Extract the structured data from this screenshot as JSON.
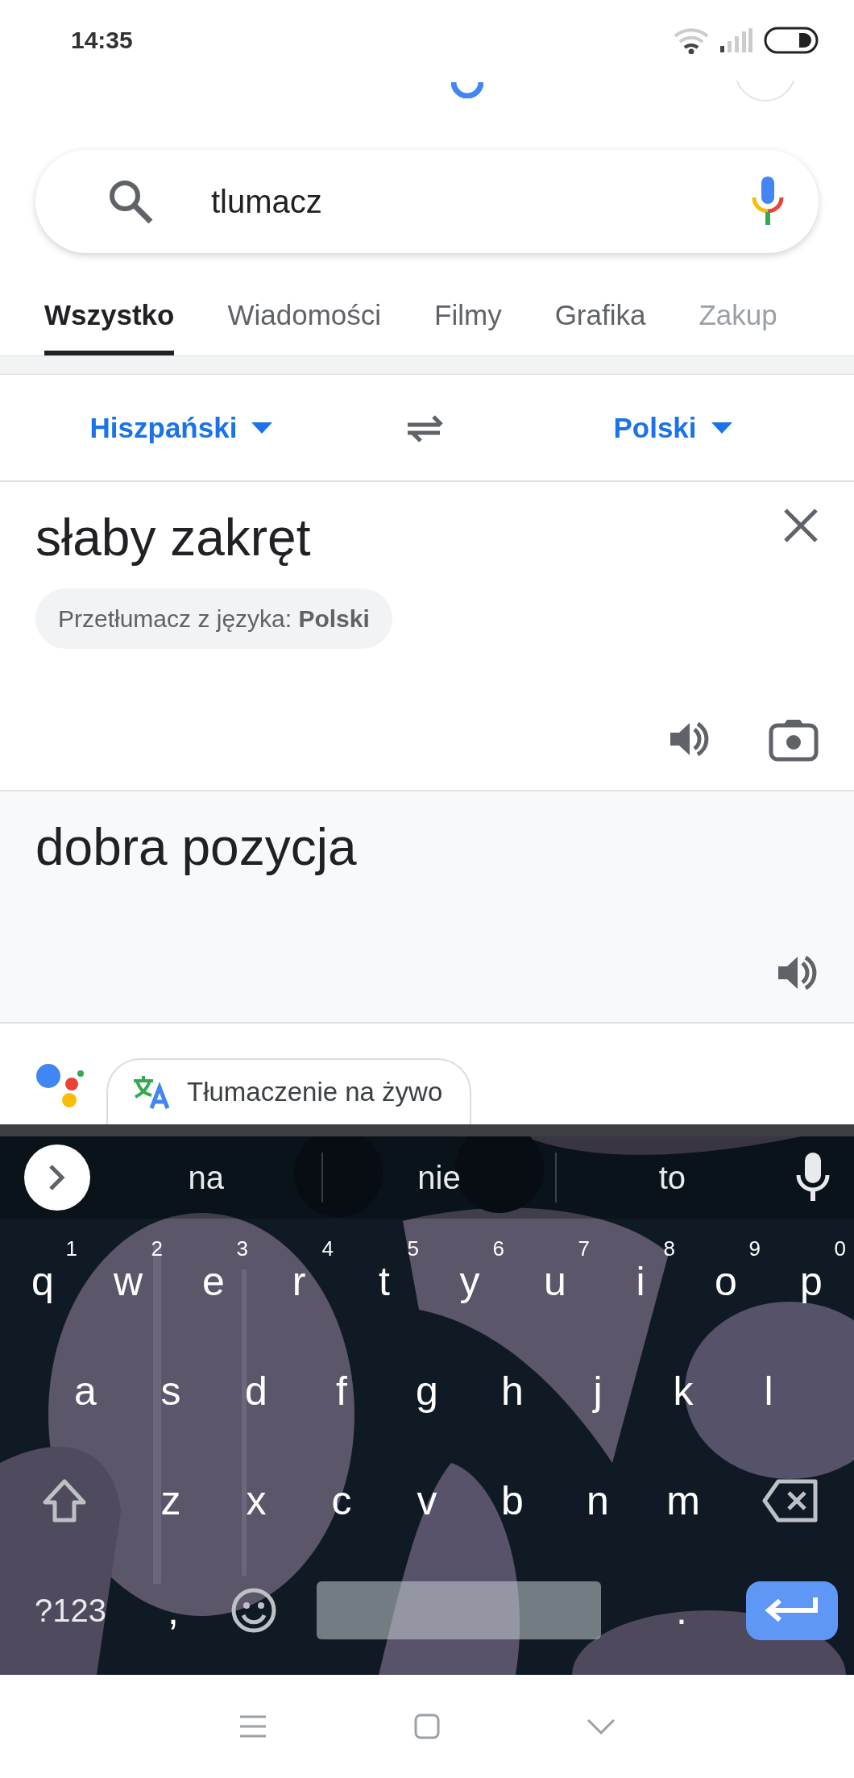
{
  "status_bar": {
    "time": "14:35"
  },
  "search": {
    "value": "tlumacz"
  },
  "tabs": [
    {
      "label": "Wszystko",
      "selected": true
    },
    {
      "label": "Wiadomości",
      "selected": false
    },
    {
      "label": "Filmy",
      "selected": false
    },
    {
      "label": "Grafika",
      "selected": false
    },
    {
      "label": "Zakup",
      "selected": false
    }
  ],
  "translator": {
    "source_language": "Hiszpański",
    "target_language": "Polski",
    "input_text": "słaby zakręt",
    "detect_chip": "Przetłumacz z języka: **Polski**",
    "output_text": "dobra pozycja"
  },
  "assistant": {
    "chip": "Tłumaczenie na żywo"
  },
  "keyboard": {
    "suggestions": [
      "na",
      "nie",
      "to"
    ],
    "rows": [
      [
        {
          "kind": "letter",
          "label": "q",
          "hint": "1"
        },
        {
          "kind": "letter",
          "label": "w",
          "hint": "2"
        },
        {
          "kind": "letter",
          "label": "e",
          "hint": "3"
        },
        {
          "kind": "letter",
          "label": "r",
          "hint": "4"
        },
        {
          "kind": "letter",
          "label": "t",
          "hint": "5"
        },
        {
          "kind": "letter",
          "label": "y",
          "hint": "6"
        },
        {
          "kind": "letter",
          "label": "u",
          "hint": "7"
        },
        {
          "kind": "letter",
          "label": "i",
          "hint": "8"
        },
        {
          "kind": "letter",
          "label": "o",
          "hint": "9"
        },
        {
          "kind": "letter",
          "label": "p",
          "hint": "0"
        }
      ],
      [
        {
          "kind": "letter",
          "label": "a"
        },
        {
          "kind": "letter",
          "label": "s"
        },
        {
          "kind": "letter",
          "label": "d"
        },
        {
          "kind": "letter",
          "label": "f"
        },
        {
          "kind": "letter",
          "label": "g"
        },
        {
          "kind": "letter",
          "label": "h"
        },
        {
          "kind": "letter",
          "label": "j"
        },
        {
          "kind": "letter",
          "label": "k"
        },
        {
          "kind": "letter",
          "label": "l"
        }
      ],
      [
        {
          "kind": "shift"
        },
        {
          "kind": "letter",
          "label": "z"
        },
        {
          "kind": "letter",
          "label": "x"
        },
        {
          "kind": "letter",
          "label": "c"
        },
        {
          "kind": "letter",
          "label": "v"
        },
        {
          "kind": "letter",
          "label": "b"
        },
        {
          "kind": "letter",
          "label": "n"
        },
        {
          "kind": "letter",
          "label": "m"
        },
        {
          "kind": "backspace"
        }
      ]
    ],
    "bottom_keys": [
      {
        "kind": "symbols",
        "label": "?123"
      },
      {
        "kind": "punct",
        "label": ","
      },
      {
        "kind": "emoji"
      },
      {
        "kind": "space"
      },
      {
        "kind": "punct",
        "label": "."
      },
      {
        "kind": "enter"
      }
    ]
  }
}
